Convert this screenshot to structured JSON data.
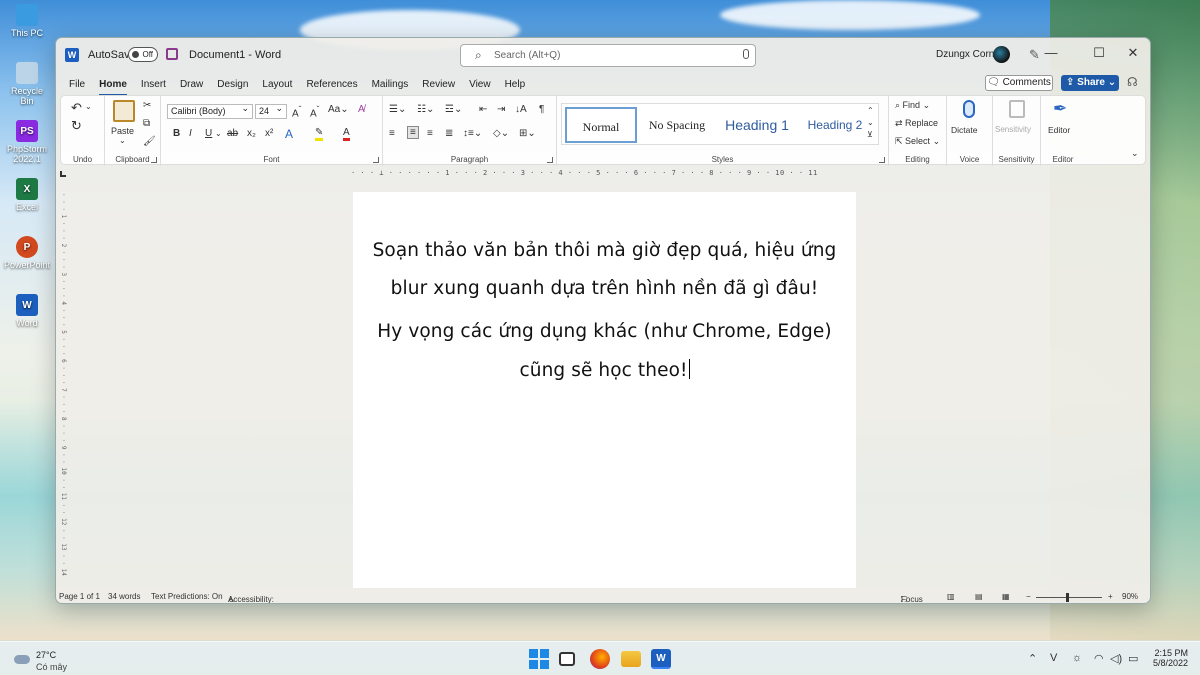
{
  "desktop": {
    "icons": [
      "This PC",
      "Recycle Bin",
      "PhpStorm 2022.1",
      "Excel",
      "PowerPoint",
      "Word"
    ]
  },
  "window": {
    "autosave_label": "AutoSave",
    "autosave_state": "Off",
    "title": "Document1  -  Word",
    "search_placeholder": "Search (Alt+Q)",
    "user_name": "Dzungx Corn"
  },
  "tabs": [
    "File",
    "Home",
    "Insert",
    "Draw",
    "Design",
    "Layout",
    "References",
    "Mailings",
    "Review",
    "View",
    "Help"
  ],
  "active_tab": "Home",
  "actions": {
    "comments": "Comments",
    "share": "Share"
  },
  "ribbon": {
    "groups": {
      "undo": "Undo",
      "clipboard": "Clipboard",
      "font": "Font",
      "paragraph": "Paragraph",
      "styles": "Styles",
      "editing": "Editing",
      "voice": "Voice",
      "sensitivity": "Sensitivity",
      "editor": "Editor"
    },
    "paste_label": "Paste",
    "font_name": "Calibri (Body)",
    "font_size": "24",
    "styles": [
      "Normal",
      "No Spacing",
      "Heading 1",
      "Heading 2"
    ],
    "find_label": "Find",
    "replace_label": "Replace",
    "select_label": "Select",
    "dictate_label": "Dictate",
    "sensitivity_label": "Sensitivity",
    "editor_label": "Editor"
  },
  "document": {
    "lines": [
      "Soạn thảo văn bản thôi mà giờ đẹp quá, hiệu ứng",
      "blur xung quanh dựa trên hình nền đã gì đâu!",
      "Hy vọng các ứng dụng khác (như Chrome, Edge)",
      "cũng sẽ học theo!"
    ]
  },
  "status": {
    "page": "Page 1 of 1",
    "words": "34 words",
    "predictions": "Text Predictions: On",
    "accessibility": "Accessibility: Good to go",
    "focus": "Focus",
    "zoom": "90%"
  },
  "taskbar": {
    "temp": "27°C",
    "condition": "Có mây",
    "time": "2:15 PM",
    "date": "5/8/2022"
  }
}
